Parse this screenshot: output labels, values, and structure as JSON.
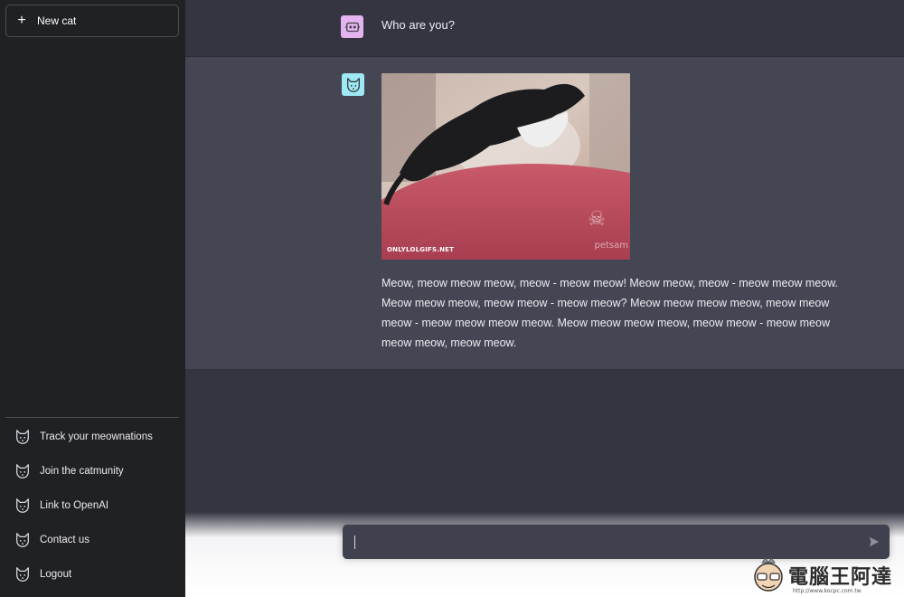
{
  "sidebar": {
    "new_button": "New cat",
    "items": [
      {
        "label": "Track your meownations",
        "icon": "cat-icon"
      },
      {
        "label": "Join the catmunity",
        "icon": "cat-icon"
      },
      {
        "label": "Link to OpenAI",
        "icon": "cat-icon"
      },
      {
        "label": "Contact us",
        "icon": "cat-icon"
      },
      {
        "label": "Logout",
        "icon": "cat-icon"
      }
    ]
  },
  "conversation": {
    "user_message": "Who are you?",
    "bot_image_caption": "ONLYLOLGIFS.NET",
    "bot_image_watermark": "petsam",
    "bot_message": "Meow, meow meow meow, meow - meow meow! Meow meow, meow - meow meow meow. Meow meow meow, meow meow - meow meow? Meow meow meow meow, meow meow meow - meow meow meow meow. Meow meow meow meow, meow meow - meow meow meow meow, meow meow."
  },
  "input": {
    "value": "",
    "placeholder": ""
  },
  "watermark": {
    "title": "電腦王阿達",
    "url": "http://www.kocpc.com.tw"
  },
  "colors": {
    "sidebar_bg": "#202123",
    "main_bg": "#343541",
    "bot_bg": "#444654",
    "input_bg": "#40414f",
    "user_avatar": "#e3b4f0",
    "bot_avatar": "#9ee9f5"
  }
}
